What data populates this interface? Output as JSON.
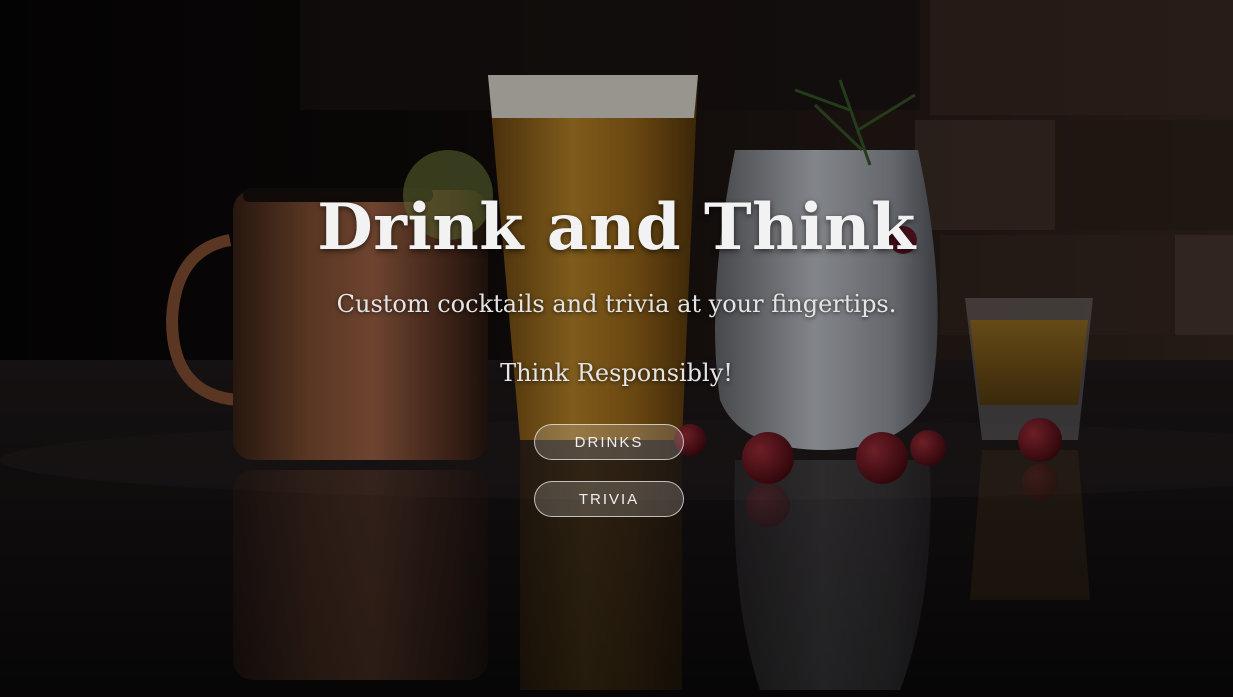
{
  "hero": {
    "title": "Drink and Think",
    "subtitle": "Custom cocktails and trivia at your fingertips.",
    "tagline": "Think Responsibly!",
    "background_image": "cocktails-on-bar-photo"
  },
  "buttons": {
    "drinks_label": "DRINKS",
    "trivia_label": "TRIVIA"
  },
  "colors": {
    "text": "#f2f2f2",
    "button_border": "#ebebeb",
    "background": "#0a0708"
  }
}
